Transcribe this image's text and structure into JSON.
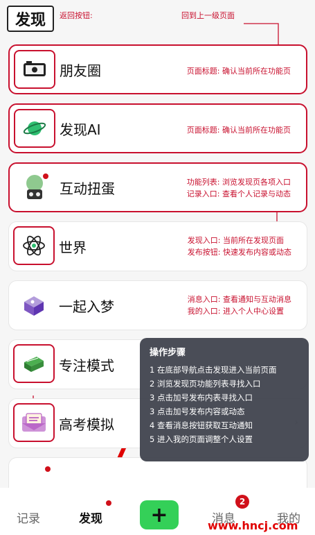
{
  "header": {
    "title": "发现",
    "back_annotation": "返回按钮:",
    "back_to_parent_annotation": "回到上一级页面"
  },
  "cards": [
    {
      "label": "朋友圈",
      "icon": "camera-frame-icon",
      "annotation_1": "页面标题: 确认当前所在功能页",
      "annotation_2": ""
    },
    {
      "label": "发现AI",
      "icon": "planet-ai-icon",
      "annotation_1": "页面标题: 确认当前所在功能页",
      "annotation_2": ""
    },
    {
      "label": "互动扭蛋",
      "icon": "gacha-machine-icon",
      "annotation_1": "功能列表: 浏览发现页各项入口",
      "annotation_2": "记录入口: 查看个人记录与动态"
    },
    {
      "label": "世界",
      "icon": "atom-icon",
      "annotation_1": "发现入口: 当前所在发现页面",
      "annotation_2": "发布按钮: 快速发布内容或动态"
    },
    {
      "label": "一起入梦",
      "icon": "dream-cube-icon",
      "annotation_1": "消息入口: 查看通知与互动消息",
      "annotation_2": "我的入口: 进入个人中心设置"
    },
    {
      "label": "专注模式",
      "icon": "books-icon",
      "annotation_1": "",
      "annotation_2": ""
    },
    {
      "label": "高考模拟",
      "icon": "exam-envelope-icon",
      "annotation_1": "",
      "annotation_2": ""
    }
  ],
  "tooltip": {
    "title": "操作步骤",
    "steps": [
      "1 在底部导航点击发现进入当前页面",
      "2 浏览发现页功能列表寻找入口",
      "3 点击加号发布内表寻找入口",
      "3 点击加号发布内容或动态",
      "4 查看消息按钮获取互动通知",
      "5 进入我的页面调整个人设置"
    ]
  },
  "bottom_nav": {
    "record": "记录",
    "discover": "发现",
    "add": "+",
    "messages": "消息",
    "messages_badge": "2",
    "me": "我的"
  },
  "watermark": "www.hncj.com",
  "colors": {
    "accent_red": "#c8102e",
    "add_green": "#34d058",
    "tooltip_bg": "#3c404a"
  }
}
